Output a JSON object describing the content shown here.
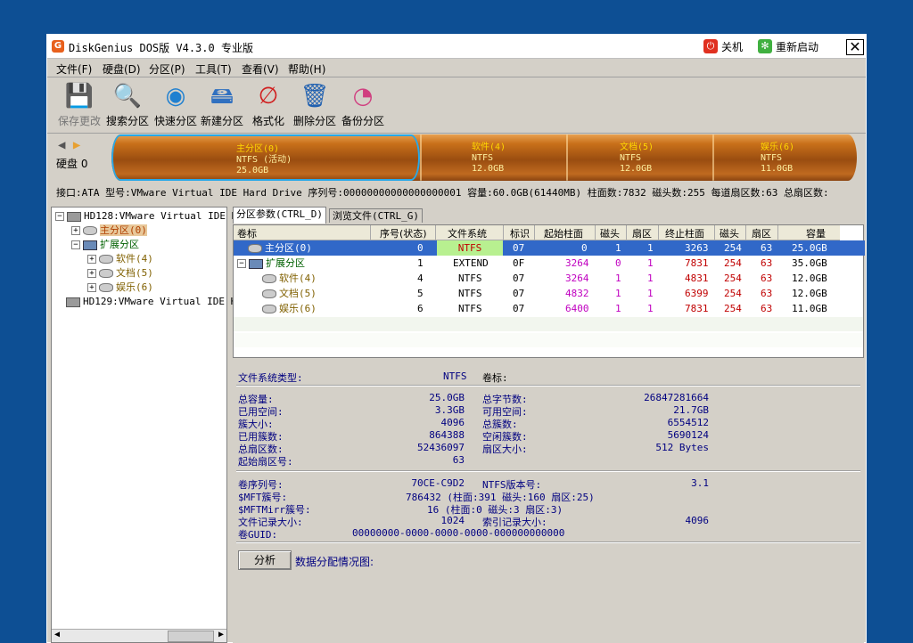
{
  "window": {
    "title": "DiskGenius DOS版 V4.3.0 专业版",
    "shutdown": "关机",
    "restart": "重新启动"
  },
  "menu": [
    "文件(F)",
    "硬盘(D)",
    "分区(P)",
    "工具(T)",
    "查看(V)",
    "帮助(H)"
  ],
  "toolbar": [
    {
      "label": "保存更改",
      "icon": "save-icon"
    },
    {
      "label": "搜索分区",
      "icon": "search-icon"
    },
    {
      "label": "快速分区",
      "icon": "quick-partition-icon"
    },
    {
      "label": "新建分区",
      "icon": "new-partition-icon"
    },
    {
      "label": "格式化",
      "icon": "format-icon"
    },
    {
      "label": "删除分区",
      "icon": "delete-icon"
    },
    {
      "label": "备份分区",
      "icon": "backup-icon"
    }
  ],
  "diskmap": {
    "disk_label": "硬盘 0",
    "segments": [
      {
        "name": "主分区(0)",
        "fs": "NTFS (活动)",
        "size": "25.0GB"
      },
      {
        "name": "软件(4)",
        "fs": "NTFS",
        "size": "12.0GB"
      },
      {
        "name": "文档(5)",
        "fs": "NTFS",
        "size": "12.0GB"
      },
      {
        "name": "娱乐(6)",
        "fs": "NTFS",
        "size": "11.0GB"
      }
    ]
  },
  "disk_info": "接口:ATA  型号:VMware Virtual IDE Hard Drive  序列号:00000000000000000001  容量:60.0GB(61440MB)  柱面数:7832  磁头数:255  每道扇区数:63  总扇区数:",
  "tree": [
    {
      "label": "HD128:VMware Virtual IDE H:"
    },
    {
      "label": "主分区(0)"
    },
    {
      "label": "扩展分区"
    },
    {
      "label": "软件(4)"
    },
    {
      "label": "文档(5)"
    },
    {
      "label": "娱乐(6)"
    },
    {
      "label": "HD129:VMware Virtual IDE H:"
    }
  ],
  "tabs": [
    "分区参数(CTRL_D)",
    "浏览文件(CTRL_G)"
  ],
  "table": {
    "headers": [
      "卷标",
      "序号(状态)",
      "文件系统",
      "标识",
      "起始柱面",
      "磁头",
      "扇区",
      "终止柱面",
      "磁头",
      "扇区",
      "容量"
    ],
    "rows": [
      [
        "主分区(0)",
        "0",
        "NTFS",
        "07",
        "0",
        "1",
        "1",
        "3263",
        "254",
        "63",
        "25.0GB"
      ],
      [
        "扩展分区",
        "1",
        "EXTEND",
        "0F",
        "3264",
        "0",
        "1",
        "7831",
        "254",
        "63",
        "35.0GB"
      ],
      [
        "软件(4)",
        "4",
        "NTFS",
        "07",
        "3264",
        "1",
        "1",
        "4831",
        "254",
        "63",
        "12.0GB"
      ],
      [
        "文档(5)",
        "5",
        "NTFS",
        "07",
        "4832",
        "1",
        "1",
        "6399",
        "254",
        "63",
        "12.0GB"
      ],
      [
        "娱乐(6)",
        "6",
        "NTFS",
        "07",
        "6400",
        "1",
        "1",
        "7831",
        "254",
        "63",
        "11.0GB"
      ]
    ]
  },
  "details": {
    "fs_type_label": "文件系统类型:",
    "fs_type": "NTFS",
    "volume_label": "卷标:",
    "left": [
      {
        "k": "总容量:",
        "v": "25.0GB"
      },
      {
        "k": "已用空间:",
        "v": "3.3GB"
      },
      {
        "k": "簇大小:",
        "v": "4096"
      },
      {
        "k": "已用簇数:",
        "v": "864388"
      },
      {
        "k": "总扇区数:",
        "v": "52436097"
      },
      {
        "k": "起始扇区号:",
        "v": "63"
      }
    ],
    "right": [
      {
        "k": "总字节数:",
        "v": "26847281664"
      },
      {
        "k": "可用空间:",
        "v": "21.7GB"
      },
      {
        "k": "总簇数:",
        "v": "6554512"
      },
      {
        "k": "空闲簇数:",
        "v": "5690124"
      },
      {
        "k": "扇区大小:",
        "v": "512 Bytes"
      }
    ],
    "serial_label": "卷序列号:",
    "serial": "70CE-C9D2",
    "ntfs_ver_label": "NTFS版本号:",
    "ntfs_ver": "3.1",
    "mft_label": "$MFT簇号:",
    "mft": "786432 (柱面:391 磁头:160 扇区:25)",
    "mftmirr_label": "$MFTMirr簇号:",
    "mftmirr": "16 (柱面:0 磁头:3 扇区:3)",
    "frs_label": "文件记录大小:",
    "frs": "1024",
    "irs_label": "索引记录大小:",
    "irs": "4096",
    "guid_label": "卷GUID:",
    "guid": "00000000-0000-0000-0000-000000000000",
    "analyze_button": "分析",
    "alloc_label": "数据分配情况图:"
  }
}
